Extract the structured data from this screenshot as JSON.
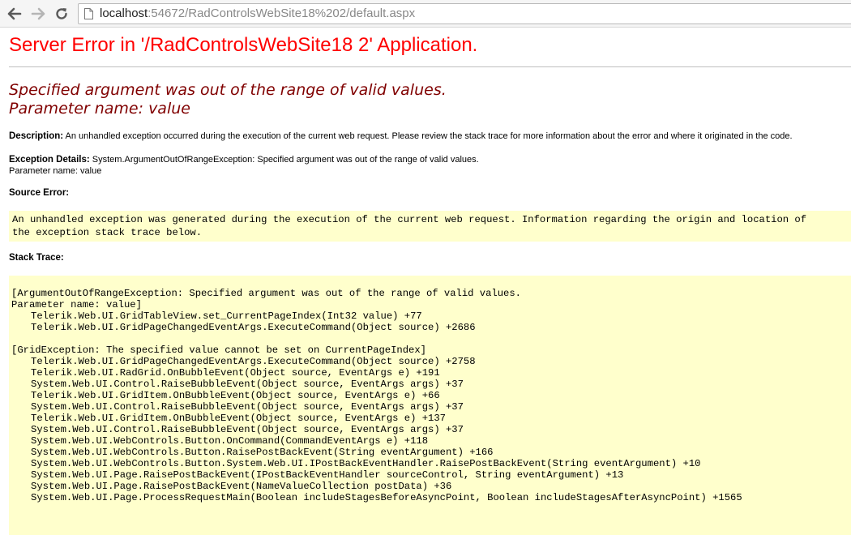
{
  "browser": {
    "url_host": "localhost",
    "url_path": ":54672/RadControlsWebSite18%202/default.aspx"
  },
  "page": {
    "title": "Server Error in '/RadControlsWebSite18 2' Application.",
    "error_message": {
      "line1": "Specified argument was out of the range of valid values.",
      "line2": "Parameter name: value"
    },
    "description": {
      "label": "Description:",
      "text": "An unhandled exception occurred during the execution of the current web request. Please review the stack trace for more information about the error and where it originated in the code."
    },
    "exception_details": {
      "label": "Exception Details:",
      "text": "System.ArgumentOutOfRangeException: Specified argument was out of the range of valid values.",
      "text2": "Parameter name: value"
    },
    "source_error": {
      "label": "Source Error:",
      "line1": "An unhandled exception was generated during the execution of the current web request. Information regarding the origin and location of",
      "line2": "the exception stack trace below."
    },
    "stack_trace": {
      "label": "Stack Trace:",
      "blocks": [
        {
          "header": "[ArgumentOutOfRangeException: Specified argument was out of the range of valid values.",
          "header2": "Parameter name: value]",
          "frames": [
            "Telerik.Web.UI.GridTableView.set_CurrentPageIndex(Int32 value) +77",
            "Telerik.Web.UI.GridPageChangedEventArgs.ExecuteCommand(Object source) +2686"
          ]
        },
        {
          "header": "[GridException: The specified value cannot be set on CurrentPageIndex]",
          "frames": [
            "Telerik.Web.UI.GridPageChangedEventArgs.ExecuteCommand(Object source) +2758",
            "Telerik.Web.UI.RadGrid.OnBubbleEvent(Object source, EventArgs e) +191",
            "System.Web.UI.Control.RaiseBubbleEvent(Object source, EventArgs args) +37",
            "Telerik.Web.UI.GridItem.OnBubbleEvent(Object source, EventArgs e) +66",
            "System.Web.UI.Control.RaiseBubbleEvent(Object source, EventArgs args) +37",
            "Telerik.Web.UI.GridItem.OnBubbleEvent(Object source, EventArgs e) +137",
            "System.Web.UI.Control.RaiseBubbleEvent(Object source, EventArgs args) +37",
            "System.Web.UI.WebControls.Button.OnCommand(CommandEventArgs e) +118",
            "System.Web.UI.WebControls.Button.RaisePostBackEvent(String eventArgument) +166",
            "System.Web.UI.WebControls.Button.System.Web.UI.IPostBackEventHandler.RaisePostBackEvent(String eventArgument) +10",
            "System.Web.UI.Page.RaisePostBackEvent(IPostBackEventHandler sourceControl, String eventArgument) +13",
            "System.Web.UI.Page.RaisePostBackEvent(NameValueCollection postData) +36",
            "System.Web.UI.Page.ProcessRequestMain(Boolean includeStagesBeforeAsyncPoint, Boolean includeStagesAfterAsyncPoint) +1565"
          ]
        }
      ]
    }
  },
  "icons": {
    "back": "back-arrow-icon",
    "forward": "forward-arrow-icon",
    "reload": "reload-icon",
    "page": "page-icon"
  }
}
